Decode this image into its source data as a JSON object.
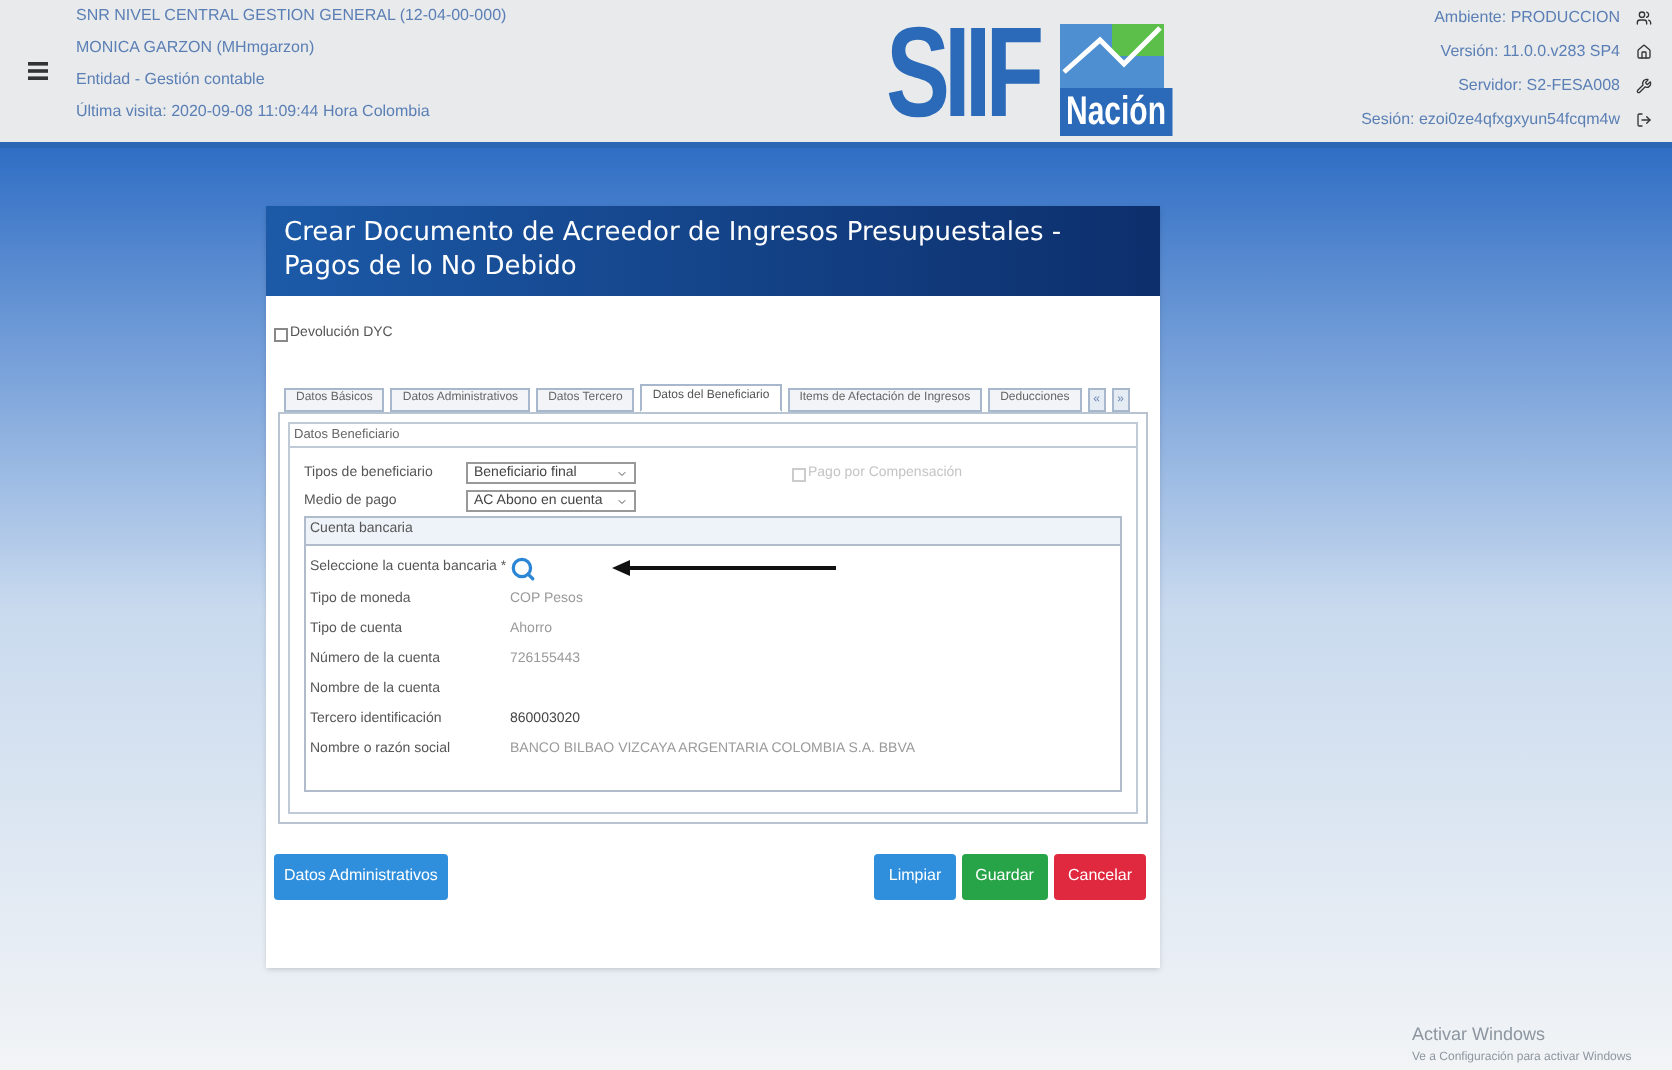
{
  "header": {
    "info_lines": [
      "SNR NIVEL CENTRAL GESTION GENERAL (12-04-00-000)",
      "MONICA GARZON (MHmgarzon)",
      "Entidad - Gestión contable",
      "Última visita: 2020-09-08 11:09:44 Hora Colombia"
    ],
    "logo": {
      "main": "SIIF",
      "sub": "Nación"
    },
    "env_lines": [
      "Ambiente: PRODUCCION",
      "Versión: 11.0.0.v283 SP4",
      "Servidor: S2-FESA008",
      "Sesión: ezoi0ze4qfxgxyun54fcqm4w"
    ]
  },
  "dialog": {
    "title": "Crear Documento de Acreedor de Ingresos Presupuestales - Pagos de lo No Debido",
    "devolucion": {
      "label": "Devolución DYC",
      "checked": false
    },
    "tabs": [
      {
        "label": "Datos Básicos",
        "selected": false
      },
      {
        "label": "Datos Administrativos",
        "selected": false
      },
      {
        "label": "Datos Tercero",
        "selected": false
      },
      {
        "label": "Datos del Beneficiario",
        "selected": true
      },
      {
        "label": "Items de Afectación de Ingresos",
        "selected": false
      },
      {
        "label": "Deducciones",
        "selected": false
      }
    ],
    "tab_scroll": [
      "«",
      "»"
    ],
    "section_title": "Datos Beneficiario",
    "tipo_beneficiario": {
      "label": "Tipos de beneficiario",
      "value": "Beneficiario final"
    },
    "medio_pago": {
      "label": "Medio de pago",
      "value": "AC Abono en cuenta"
    },
    "pago_compensacion": {
      "label": "Pago por Compensación",
      "checked": false,
      "disabled": true
    },
    "cuenta": {
      "title": "Cuenta bancaria",
      "select_label": "Seleccione la cuenta bancaria *",
      "rows": [
        {
          "label": "Tipo de moneda",
          "value": "COP Pesos",
          "dim": true
        },
        {
          "label": "Tipo de cuenta",
          "value": "Ahorro",
          "dim": true
        },
        {
          "label": "Número de la cuenta",
          "value": "726155443",
          "dim": true
        },
        {
          "label": "Nombre de la cuenta"
        },
        {
          "label": "Tercero identificación",
          "value": "860003020",
          "dim": false
        },
        {
          "label": "Nombre o razón social",
          "value": "BANCO BILBAO VIZCAYA ARGENTARIA COLOMBIA S.A. BBVA",
          "dim": true
        }
      ]
    },
    "buttons": [
      {
        "label": "Datos Administrativos",
        "kind": "nav"
      },
      {
        "label": "Limpiar",
        "kind": "primary"
      },
      {
        "label": "Guardar",
        "kind": "success"
      },
      {
        "label": "Cancelar",
        "kind": "danger"
      }
    ]
  },
  "windows_notice": [
    "Activar Windows",
    "Ve a Configuración para activar Windows"
  ]
}
